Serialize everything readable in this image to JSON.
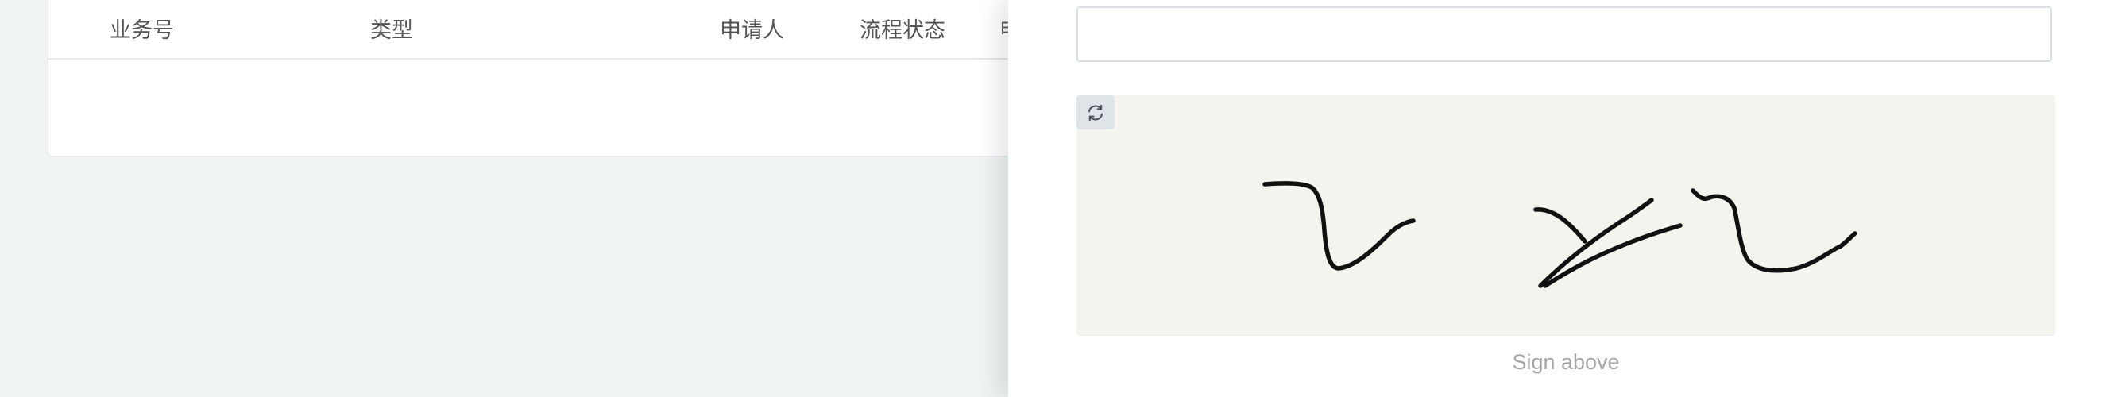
{
  "table": {
    "headers": [
      "业务号",
      "类型",
      "申请人",
      "流程状态",
      "申"
    ]
  },
  "drawer": {
    "input": {
      "value": "",
      "placeholder": ""
    },
    "signature_pad": {
      "refresh_icon": "refresh-icon",
      "background_color": "#f4f4ee",
      "stroke_color": "#111111",
      "hint": "Sign above"
    }
  }
}
